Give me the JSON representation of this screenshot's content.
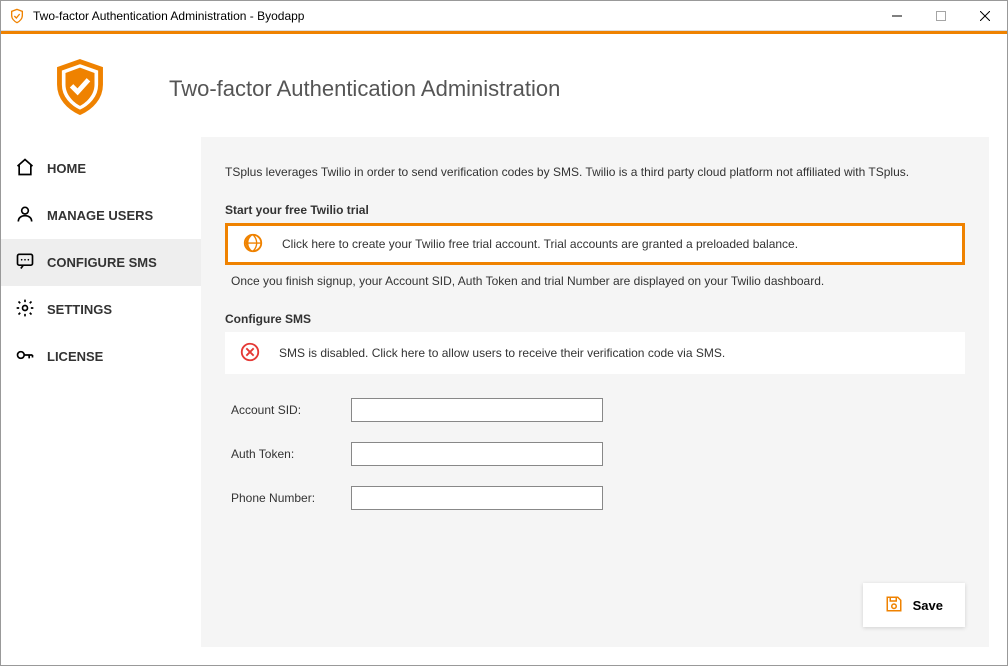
{
  "window": {
    "title": "Two-factor Authentication Administration -   Byodapp"
  },
  "header": {
    "title": "Two-factor Authentication Administration"
  },
  "sidebar": {
    "items": [
      {
        "label": "HOME",
        "name": "sidebar-item-home"
      },
      {
        "label": "MANAGE USERS",
        "name": "sidebar-item-manage-users"
      },
      {
        "label": "CONFIGURE SMS",
        "name": "sidebar-item-configure-sms",
        "selected": true
      },
      {
        "label": "SETTINGS",
        "name": "sidebar-item-settings"
      },
      {
        "label": "LICENSE",
        "name": "sidebar-item-license"
      }
    ]
  },
  "content": {
    "intro": "TSplus leverages Twilio in order to send verification codes by SMS. Twilio is a third party cloud platform not affiliated with TSplus.",
    "trial": {
      "heading": "Start your free Twilio trial",
      "link_text": "Click here to create your Twilio free trial account. Trial accounts are granted a preloaded balance.",
      "after": "Once you finish signup, your Account SID, Auth Token and trial Number are displayed on your Twilio dashboard."
    },
    "configure": {
      "heading": "Configure SMS",
      "status": "SMS is disabled. Click here to allow users to receive their verification code via SMS.",
      "fields": {
        "account_sid_label": "Account SID:",
        "account_sid_value": "",
        "auth_token_label": "Auth Token:",
        "auth_token_value": "",
        "phone_number_label": "Phone Number:",
        "phone_number_value": ""
      },
      "save_label": "Save"
    }
  },
  "colors": {
    "accent": "#ef8200",
    "error": "#e53935"
  }
}
